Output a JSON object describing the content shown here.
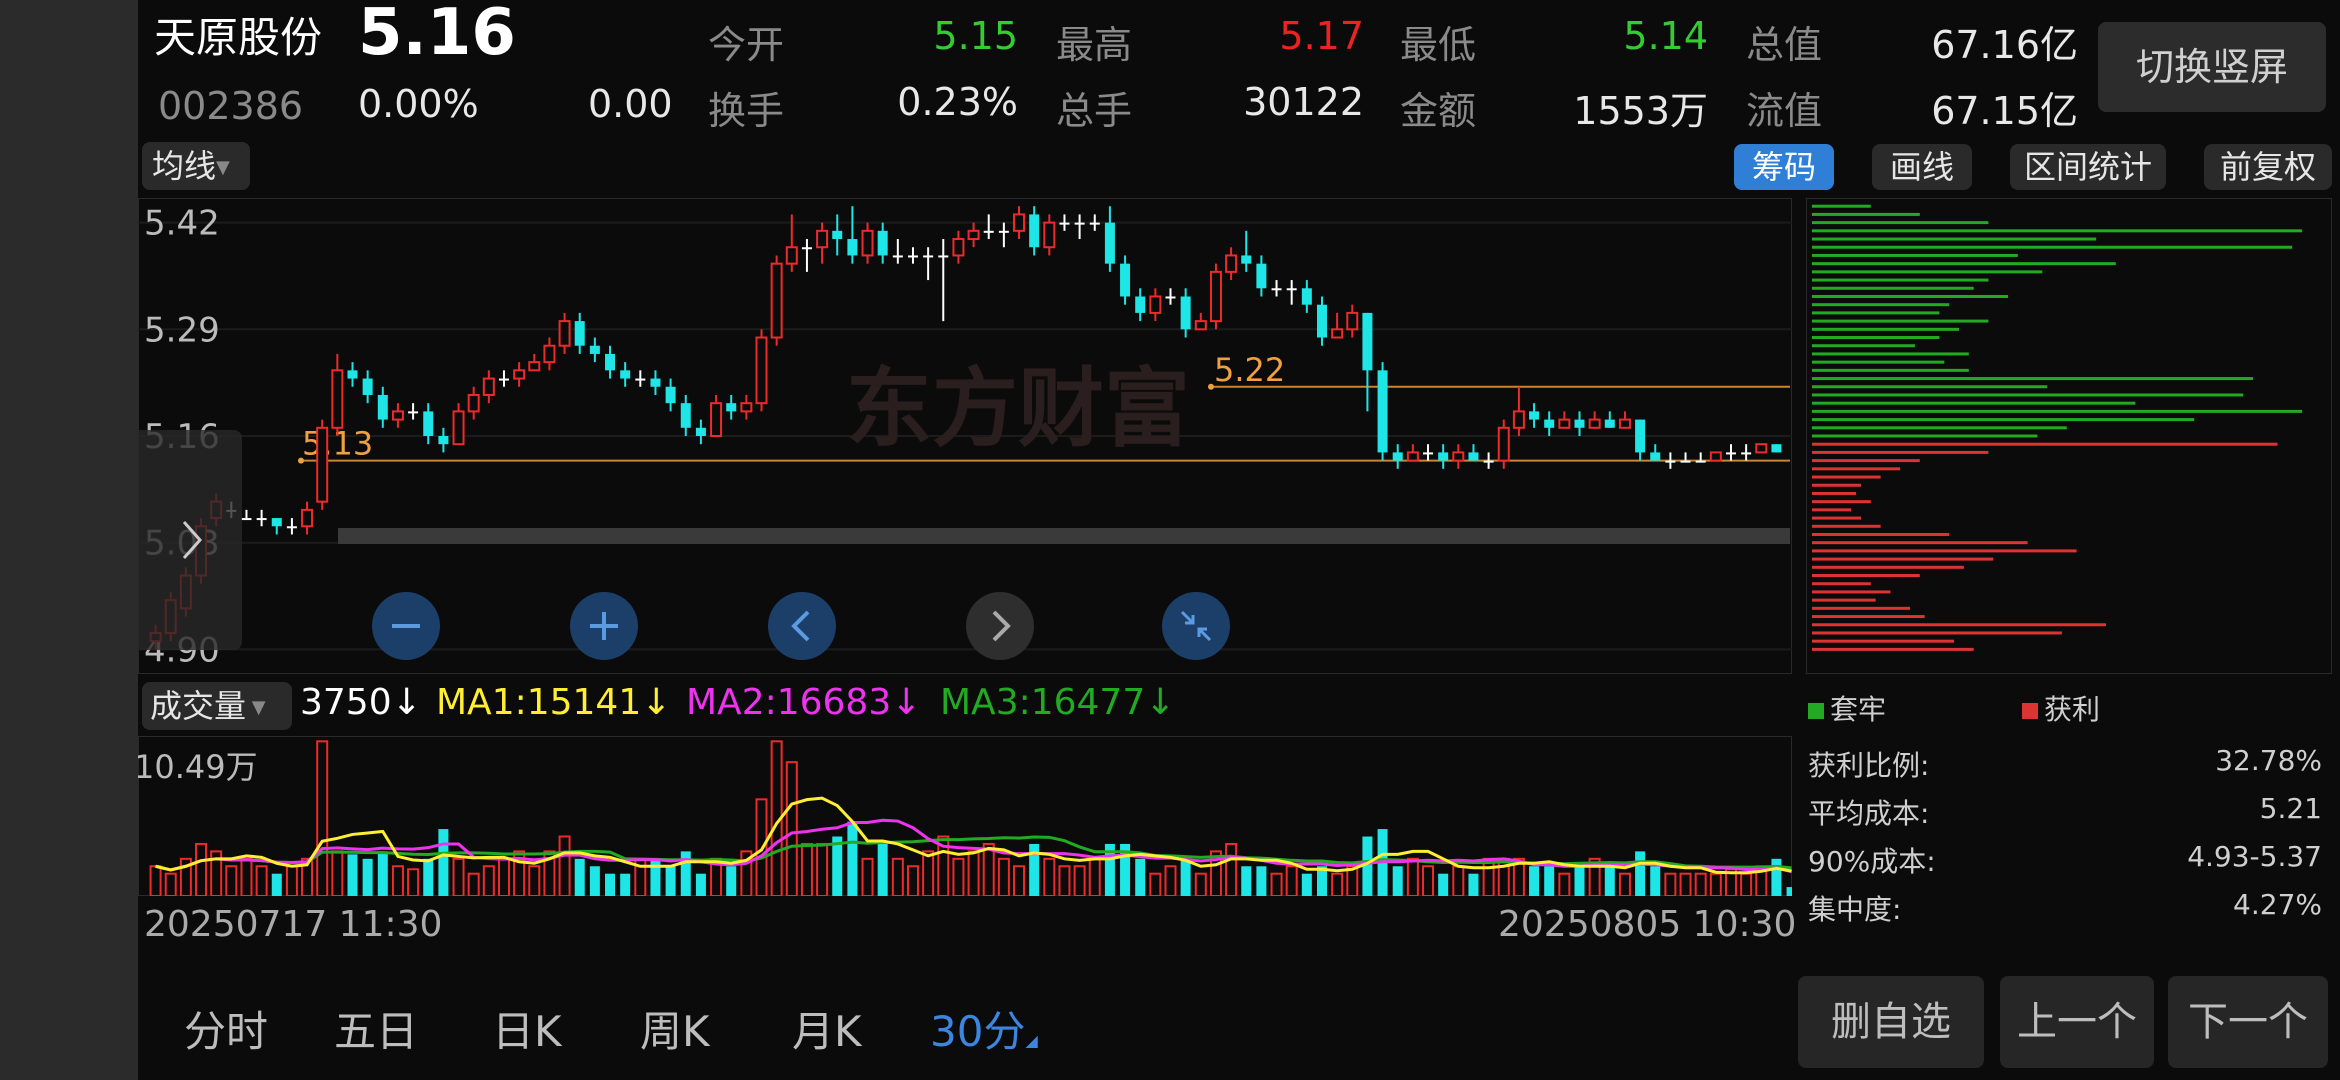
{
  "header": {
    "stock_name": "天原股份",
    "stock_code": "002386",
    "price": "5.16",
    "change_pct": "0.00%",
    "change_amt": "0.00",
    "quotes": [
      {
        "label": "今开",
        "value": "5.15",
        "color": "#33cc33"
      },
      {
        "label": "最高",
        "value": "5.17",
        "color": "#ee2222"
      },
      {
        "label": "最低",
        "value": "5.14",
        "color": "#33cc33"
      },
      {
        "label": "总值",
        "value": "67.16亿",
        "color": "#e8e8e8"
      },
      {
        "label": "换手",
        "value": "0.23%",
        "color": "#e8e8e8"
      },
      {
        "label": "总手",
        "value": "30122",
        "color": "#e8e8e8"
      },
      {
        "label": "金额",
        "value": "1553万",
        "color": "#e8e8e8"
      },
      {
        "label": "流值",
        "value": "67.15亿",
        "color": "#e8e8e8"
      }
    ],
    "switch_button": "切换竖屏"
  },
  "toolbar": {
    "ma_dropdown": "均线",
    "chips_button": "筹码",
    "draw_button": "画线",
    "range_stats_button": "区间统计",
    "fq_button": "前复权"
  },
  "price_axis": {
    "labels": [
      "5.42",
      "5.29",
      "5.16",
      "5.03",
      "4.90"
    ]
  },
  "annotations": {
    "low_marker": "5.13",
    "high_marker": "5.22"
  },
  "watermark": "东方财富",
  "volume": {
    "dropdown": "成交量",
    "current": "3750",
    "current_arrow": "↓",
    "ma1": "MA1:15141",
    "ma1_arrow": "↓",
    "ma2": "MA2:16683",
    "ma2_arrow": "↓",
    "ma3": "MA3:16477",
    "ma3_arrow": "↓",
    "max_label": "10.49万",
    "ma1_color": "#ffee33",
    "ma2_color": "#ee33ee",
    "ma3_color": "#22aa22"
  },
  "dates": {
    "start": "20250717 11:30",
    "end": "20250805 10:30"
  },
  "chips_panel": {
    "legend_trapped": "套牢",
    "legend_profit": "获利",
    "trapped_color": "#22aa22",
    "profit_color": "#dd3333",
    "stats": [
      {
        "label": "获利比例:",
        "value": "32.78%"
      },
      {
        "label": "平均成本:",
        "value": "5.21"
      },
      {
        "label": "90%成本:",
        "value": "4.93-5.37"
      },
      {
        "label": "集中度:",
        "value": "4.27%"
      }
    ]
  },
  "period_tabs": [
    "分时",
    "五日",
    "日K",
    "周K",
    "月K",
    "30分"
  ],
  "active_period": "30分",
  "bottom_buttons": {
    "remove_watch": "删自选",
    "prev": "上一个",
    "next": "下一个"
  },
  "colors": {
    "up": "#ee2a2a",
    "down": "#1ee6e6",
    "accent_blue": "#2f7fd6",
    "orange": "#f0a040"
  },
  "chart_data": {
    "type": "candlestick",
    "title": "",
    "ylim": [
      4.87,
      5.45
    ],
    "candles": [
      [
        4.91,
        4.92,
        4.93,
        4.9
      ],
      [
        4.92,
        4.96,
        4.97,
        4.91
      ],
      [
        4.95,
        4.99,
        5.0,
        4.94
      ],
      [
        4.99,
        5.05,
        5.06,
        4.98
      ],
      [
        5.06,
        5.08,
        5.09,
        5.05
      ],
      [
        5.07,
        5.07,
        5.08,
        5.06
      ],
      [
        5.06,
        5.06,
        5.07,
        5.06
      ],
      [
        5.06,
        5.06,
        5.07,
        5.05
      ],
      [
        5.06,
        5.05,
        5.06,
        5.04
      ],
      [
        5.05,
        5.05,
        5.06,
        5.04
      ],
      [
        5.05,
        5.07,
        5.08,
        5.04
      ],
      [
        5.08,
        5.17,
        5.18,
        5.07
      ],
      [
        5.17,
        5.24,
        5.26,
        5.16
      ],
      [
        5.24,
        5.23,
        5.25,
        5.22
      ],
      [
        5.23,
        5.21,
        5.24,
        5.2
      ],
      [
        5.21,
        5.18,
        5.22,
        5.17
      ],
      [
        5.18,
        5.19,
        5.2,
        5.17
      ],
      [
        5.19,
        5.19,
        5.2,
        5.18
      ],
      [
        5.19,
        5.16,
        5.2,
        5.15
      ],
      [
        5.16,
        5.15,
        5.17,
        5.14
      ],
      [
        5.15,
        5.19,
        5.2,
        5.15
      ],
      [
        5.19,
        5.21,
        5.22,
        5.18
      ],
      [
        5.21,
        5.23,
        5.24,
        5.2
      ],
      [
        5.23,
        5.23,
        5.24,
        5.22
      ],
      [
        5.23,
        5.24,
        5.25,
        5.22
      ],
      [
        5.24,
        5.25,
        5.26,
        5.24
      ],
      [
        5.25,
        5.27,
        5.28,
        5.24
      ],
      [
        5.27,
        5.3,
        5.31,
        5.26
      ],
      [
        5.3,
        5.27,
        5.31,
        5.26
      ],
      [
        5.27,
        5.26,
        5.28,
        5.25
      ],
      [
        5.26,
        5.24,
        5.27,
        5.23
      ],
      [
        5.24,
        5.23,
        5.25,
        5.22
      ],
      [
        5.23,
        5.23,
        5.24,
        5.22
      ],
      [
        5.23,
        5.22,
        5.24,
        5.21
      ],
      [
        5.22,
        5.2,
        5.23,
        5.19
      ],
      [
        5.2,
        5.17,
        5.21,
        5.16
      ],
      [
        5.17,
        5.16,
        5.18,
        5.15
      ],
      [
        5.16,
        5.2,
        5.21,
        5.16
      ],
      [
        5.2,
        5.19,
        5.21,
        5.18
      ],
      [
        5.19,
        5.2,
        5.21,
        5.18
      ],
      [
        5.2,
        5.28,
        5.29,
        5.19
      ],
      [
        5.28,
        5.37,
        5.38,
        5.27
      ],
      [
        5.37,
        5.39,
        5.43,
        5.36
      ],
      [
        5.39,
        5.39,
        5.4,
        5.36
      ],
      [
        5.39,
        5.41,
        5.42,
        5.37
      ],
      [
        5.41,
        5.4,
        5.43,
        5.38
      ],
      [
        5.4,
        5.38,
        5.44,
        5.37
      ],
      [
        5.38,
        5.41,
        5.42,
        5.37
      ],
      [
        5.41,
        5.38,
        5.42,
        5.37
      ],
      [
        5.38,
        5.38,
        5.4,
        5.37
      ],
      [
        5.38,
        5.38,
        5.39,
        5.37
      ],
      [
        5.38,
        5.38,
        5.39,
        5.35
      ],
      [
        5.38,
        5.38,
        5.4,
        5.3
      ],
      [
        5.38,
        5.4,
        5.41,
        5.37
      ],
      [
        5.4,
        5.41,
        5.42,
        5.39
      ],
      [
        5.41,
        5.41,
        5.43,
        5.4
      ],
      [
        5.41,
        5.41,
        5.42,
        5.39
      ],
      [
        5.41,
        5.43,
        5.44,
        5.4
      ],
      [
        5.43,
        5.39,
        5.44,
        5.38
      ],
      [
        5.39,
        5.42,
        5.43,
        5.38
      ],
      [
        5.42,
        5.42,
        5.43,
        5.41
      ],
      [
        5.42,
        5.42,
        5.43,
        5.4
      ],
      [
        5.42,
        5.42,
        5.43,
        5.41
      ],
      [
        5.42,
        5.37,
        5.44,
        5.36
      ],
      [
        5.37,
        5.33,
        5.38,
        5.32
      ],
      [
        5.33,
        5.31,
        5.34,
        5.3
      ],
      [
        5.31,
        5.33,
        5.34,
        5.3
      ],
      [
        5.33,
        5.33,
        5.34,
        5.32
      ],
      [
        5.33,
        5.29,
        5.34,
        5.28
      ],
      [
        5.29,
        5.3,
        5.31,
        5.29
      ],
      [
        5.3,
        5.36,
        5.37,
        5.29
      ],
      [
        5.36,
        5.38,
        5.39,
        5.35
      ],
      [
        5.38,
        5.37,
        5.41,
        5.36
      ],
      [
        5.37,
        5.34,
        5.38,
        5.33
      ],
      [
        5.34,
        5.34,
        5.35,
        5.33
      ],
      [
        5.34,
        5.34,
        5.35,
        5.32
      ],
      [
        5.34,
        5.32,
        5.35,
        5.31
      ],
      [
        5.32,
        5.28,
        5.33,
        5.27
      ],
      [
        5.28,
        5.29,
        5.31,
        5.28
      ],
      [
        5.29,
        5.31,
        5.32,
        5.28
      ],
      [
        5.31,
        5.24,
        5.31,
        5.19
      ],
      [
        5.24,
        5.14,
        5.25,
        5.13
      ],
      [
        5.14,
        5.13,
        5.15,
        5.12
      ],
      [
        5.13,
        5.14,
        5.15,
        5.13
      ],
      [
        5.14,
        5.14,
        5.15,
        5.13
      ],
      [
        5.14,
        5.13,
        5.15,
        5.12
      ],
      [
        5.13,
        5.14,
        5.15,
        5.12
      ],
      [
        5.14,
        5.13,
        5.15,
        5.13
      ],
      [
        5.13,
        5.13,
        5.14,
        5.12
      ],
      [
        5.13,
        5.17,
        5.18,
        5.12
      ],
      [
        5.17,
        5.19,
        5.22,
        5.16
      ],
      [
        5.19,
        5.18,
        5.2,
        5.17
      ],
      [
        5.18,
        5.17,
        5.19,
        5.16
      ],
      [
        5.17,
        5.18,
        5.19,
        5.17
      ],
      [
        5.18,
        5.17,
        5.19,
        5.16
      ],
      [
        5.17,
        5.18,
        5.19,
        5.17
      ],
      [
        5.18,
        5.17,
        5.19,
        5.17
      ],
      [
        5.17,
        5.18,
        5.19,
        5.17
      ],
      [
        5.18,
        5.14,
        5.18,
        5.13
      ],
      [
        5.14,
        5.13,
        5.15,
        5.13
      ],
      [
        5.13,
        5.13,
        5.14,
        5.12
      ],
      [
        5.13,
        5.13,
        5.14,
        5.13
      ],
      [
        5.13,
        5.13,
        5.14,
        5.13
      ],
      [
        5.13,
        5.14,
        5.14,
        5.13
      ],
      [
        5.14,
        5.14,
        5.15,
        5.13
      ],
      [
        5.14,
        5.14,
        5.15,
        5.13
      ],
      [
        5.14,
        5.15,
        5.15,
        5.14
      ],
      [
        5.15,
        5.14,
        5.15,
        5.14
      ]
    ],
    "volumes": [
      2.0,
      1.5,
      2.5,
      3.5,
      3.0,
      2.0,
      2.5,
      2.0,
      1.5,
      2.0,
      2.5,
      10.4,
      3.0,
      2.8,
      2.5,
      3.0,
      2.0,
      1.8,
      2.5,
      4.5,
      2.5,
      1.5,
      2.0,
      2.5,
      3.0,
      2.0,
      3.0,
      4.0,
      2.5,
      2.0,
      1.5,
      1.5,
      2.5,
      2.5,
      2.0,
      3.0,
      1.5,
      2.5,
      2.0,
      3.0,
      6.5,
      10.4,
      9.0,
      3.5,
      3.5,
      4.0,
      5.0,
      2.5,
      3.5,
      2.5,
      2.0,
      3.0,
      4.0,
      2.5,
      3.0,
      3.5,
      2.5,
      2.0,
      3.5,
      2.5,
      2.0,
      2.0,
      2.5,
      3.5,
      3.5,
      2.5,
      1.5,
      2.0,
      2.5,
      1.5,
      3.0,
      3.5,
      2.0,
      2.0,
      1.5,
      2.0,
      1.5,
      2.0,
      1.5,
      2.0,
      4.0,
      4.5,
      2.0,
      2.5,
      2.0,
      1.5,
      2.0,
      1.5,
      2.5,
      2.5,
      2.5,
      2.0,
      2.0,
      1.5,
      2.0,
      2.5,
      2.0,
      1.5,
      3.0,
      2.0,
      1.5,
      1.5,
      1.5,
      1.5,
      1.8,
      1.5,
      2.0,
      2.5,
      0.6
    ],
    "chip_distribution": [
      {
        "price": 5.44,
        "len": 0.12,
        "kind": "trapped"
      },
      {
        "price": 5.43,
        "len": 0.22,
        "kind": "trapped"
      },
      {
        "price": 5.42,
        "len": 0.36,
        "kind": "trapped"
      },
      {
        "price": 5.41,
        "len": 1.0,
        "kind": "trapped"
      },
      {
        "price": 5.4,
        "len": 0.58,
        "kind": "trapped"
      },
      {
        "price": 5.39,
        "len": 0.98,
        "kind": "trapped"
      },
      {
        "price": 5.38,
        "len": 0.42,
        "kind": "trapped"
      },
      {
        "price": 5.37,
        "len": 0.62,
        "kind": "trapped"
      },
      {
        "price": 5.36,
        "len": 0.47,
        "kind": "trapped"
      },
      {
        "price": 5.35,
        "len": 0.36,
        "kind": "trapped"
      },
      {
        "price": 5.34,
        "len": 0.33,
        "kind": "trapped"
      },
      {
        "price": 5.33,
        "len": 0.4,
        "kind": "trapped"
      },
      {
        "price": 5.32,
        "len": 0.28,
        "kind": "trapped"
      },
      {
        "price": 5.31,
        "len": 0.26,
        "kind": "trapped"
      },
      {
        "price": 5.3,
        "len": 0.36,
        "kind": "trapped"
      },
      {
        "price": 5.29,
        "len": 0.3,
        "kind": "trapped"
      },
      {
        "price": 5.28,
        "len": 0.26,
        "kind": "trapped"
      },
      {
        "price": 5.27,
        "len": 0.21,
        "kind": "trapped"
      },
      {
        "price": 5.26,
        "len": 0.32,
        "kind": "trapped"
      },
      {
        "price": 5.25,
        "len": 0.27,
        "kind": "trapped"
      },
      {
        "price": 5.24,
        "len": 0.32,
        "kind": "trapped"
      },
      {
        "price": 5.23,
        "len": 0.9,
        "kind": "trapped"
      },
      {
        "price": 5.22,
        "len": 0.48,
        "kind": "trapped"
      },
      {
        "price": 5.21,
        "len": 0.88,
        "kind": "trapped"
      },
      {
        "price": 5.2,
        "len": 0.66,
        "kind": "trapped"
      },
      {
        "price": 5.19,
        "len": 1.0,
        "kind": "trapped"
      },
      {
        "price": 5.18,
        "len": 0.78,
        "kind": "trapped"
      },
      {
        "price": 5.17,
        "len": 0.52,
        "kind": "trapped"
      },
      {
        "price": 5.16,
        "len": 0.46,
        "kind": "trapped"
      },
      {
        "price": 5.15,
        "len": 0.95,
        "kind": "profit"
      },
      {
        "price": 5.14,
        "len": 0.36,
        "kind": "profit"
      },
      {
        "price": 5.13,
        "len": 0.22,
        "kind": "profit"
      },
      {
        "price": 5.12,
        "len": 0.18,
        "kind": "profit"
      },
      {
        "price": 5.11,
        "len": 0.14,
        "kind": "profit"
      },
      {
        "price": 5.1,
        "len": 0.1,
        "kind": "profit"
      },
      {
        "price": 5.09,
        "len": 0.09,
        "kind": "profit"
      },
      {
        "price": 5.08,
        "len": 0.12,
        "kind": "profit"
      },
      {
        "price": 5.07,
        "len": 0.08,
        "kind": "profit"
      },
      {
        "price": 5.06,
        "len": 0.1,
        "kind": "profit"
      },
      {
        "price": 5.05,
        "len": 0.14,
        "kind": "profit"
      },
      {
        "price": 5.04,
        "len": 0.28,
        "kind": "profit"
      },
      {
        "price": 5.03,
        "len": 0.44,
        "kind": "profit"
      },
      {
        "price": 5.02,
        "len": 0.54,
        "kind": "profit"
      },
      {
        "price": 5.01,
        "len": 0.37,
        "kind": "profit"
      },
      {
        "price": 5.0,
        "len": 0.31,
        "kind": "profit"
      },
      {
        "price": 4.99,
        "len": 0.22,
        "kind": "profit"
      },
      {
        "price": 4.98,
        "len": 0.12,
        "kind": "profit"
      },
      {
        "price": 4.97,
        "len": 0.16,
        "kind": "profit"
      },
      {
        "price": 4.96,
        "len": 0.13,
        "kind": "profit"
      },
      {
        "price": 4.95,
        "len": 0.2,
        "kind": "profit"
      },
      {
        "price": 4.94,
        "len": 0.23,
        "kind": "profit"
      },
      {
        "price": 4.93,
        "len": 0.6,
        "kind": "profit"
      },
      {
        "price": 4.92,
        "len": 0.51,
        "kind": "profit"
      },
      {
        "price": 4.91,
        "len": 0.29,
        "kind": "profit"
      },
      {
        "price": 4.9,
        "len": 0.33,
        "kind": "profit"
      }
    ]
  }
}
